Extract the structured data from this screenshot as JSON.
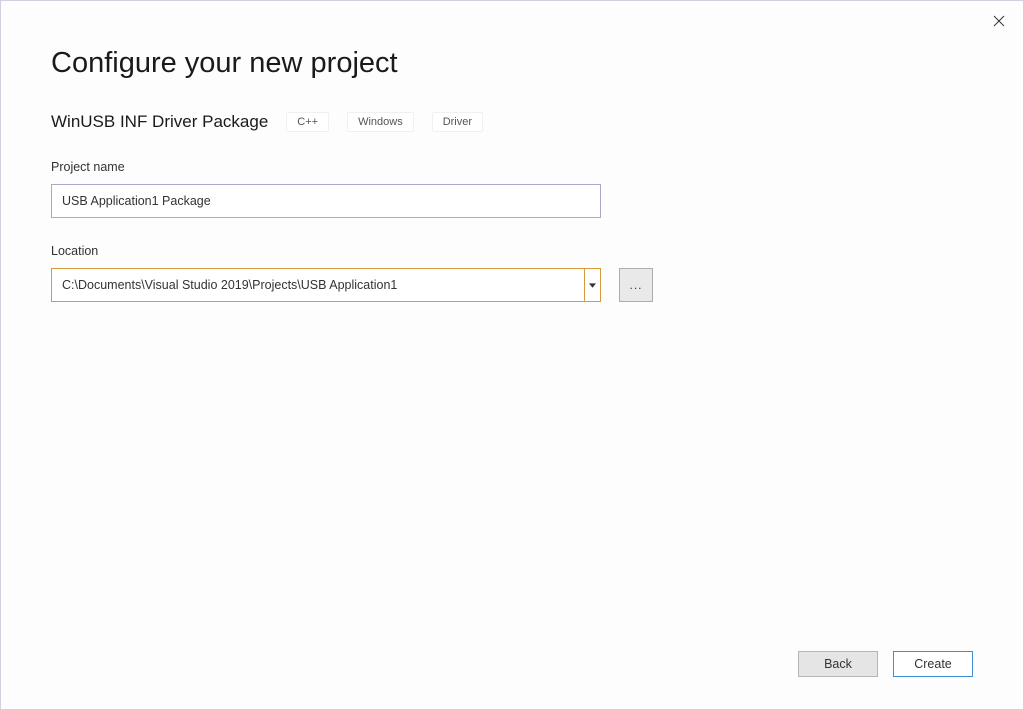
{
  "header": {
    "title": "Configure your new project"
  },
  "template": {
    "name": "WinUSB INF Driver Package",
    "tags": [
      "C++",
      "Windows",
      "Driver"
    ]
  },
  "fields": {
    "projectName": {
      "label": "Project name",
      "value": "USB Application1 Package"
    },
    "location": {
      "label": "Location",
      "value": "C:\\Documents\\Visual Studio 2019\\Projects\\USB Application1",
      "browseLabel": "..."
    }
  },
  "footer": {
    "back": "Back",
    "create": "Create"
  }
}
